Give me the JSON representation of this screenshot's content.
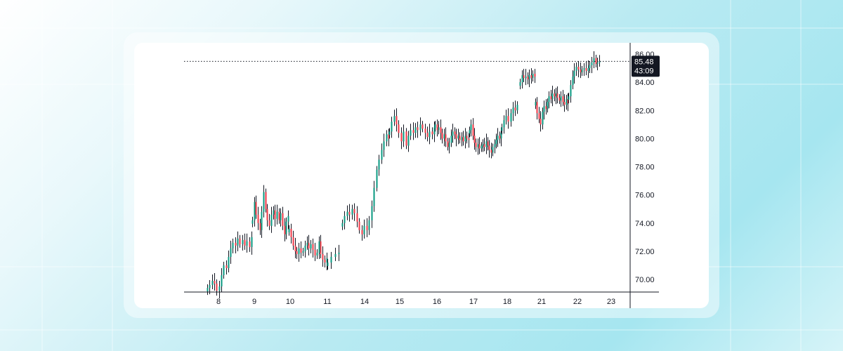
{
  "chart_data": {
    "type": "candlestick",
    "title": "",
    "xlabel": "",
    "ylabel": "",
    "ylim": [
      69.0,
      86.6
    ],
    "y_ticks": [
      "70.00",
      "72.00",
      "74.00",
      "76.00",
      "78.00",
      "80.00",
      "82.00",
      "84.00",
      "86.00"
    ],
    "x_ticks": [
      "8",
      "9",
      "10",
      "11",
      "14",
      "15",
      "16",
      "17",
      "18",
      "21",
      "22",
      "23"
    ],
    "last_price": "85.48",
    "countdown": "43:09",
    "grid": false,
    "legend": "none",
    "colors": {
      "up": "#089981",
      "down": "#f23645",
      "wick": "#131722",
      "badge": "#131722"
    },
    "sessions": [
      {
        "day": "8",
        "prices": [
          69.4,
          69.6,
          69.9,
          69.7,
          69.2,
          69.5,
          70.3,
          71.0,
          70.8,
          71.6,
          72.2,
          72.6,
          72.4,
          72.9,
          72.5,
          72.8,
          72.4,
          72.7,
          72.3,
          73.0
        ]
      },
      {
        "day": "9",
        "prices": [
          74.2,
          75.5,
          74.6,
          74.0,
          73.5,
          74.8,
          76.2,
          75.0,
          74.2,
          73.8,
          74.6,
          74.9,
          74.3,
          74.8,
          74.2,
          74.7,
          73.8,
          73.2,
          74.1,
          74.5
        ]
      },
      {
        "day": "10",
        "prices": [
          73.6,
          73.0,
          72.4,
          72.0,
          71.8,
          72.2,
          71.9,
          72.0,
          72.4,
          72.6,
          72.2,
          72.5,
          72.1,
          71.7,
          71.9,
          72.7,
          71.8,
          71.4,
          71.2,
          71.5
        ]
      },
      {
        "day": "11",
        "prices": [
          71.2,
          71.6,
          71.8,
          71.9
        ]
      },
      {
        "day": "14",
        "prices": [
          74.0,
          74.5,
          74.8,
          74.6,
          75.0,
          74.7,
          74.1,
          73.5,
          73.2,
          73.8,
          73.5,
          74.2,
          75.2,
          76.5,
          77.8,
          78.5,
          79.2,
          79.8,
          80.3,
          80.0
        ]
      },
      {
        "day": "15",
        "prices": [
          80.5,
          81.2,
          81.6,
          81.0,
          80.4,
          79.8,
          80.5,
          79.5,
          80.2,
          80.6,
          80.4,
          80.8,
          80.6,
          81.0,
          80.7,
          80.4,
          80.1,
          80.5,
          80.3,
          80.8
        ]
      },
      {
        "day": "16",
        "prices": [
          81.0,
          80.6,
          80.8,
          80.4,
          80.0,
          80.3,
          79.8,
          79.4,
          79.7,
          80.2,
          80.5,
          80.3,
          80.0,
          80.2,
          79.9,
          80.1,
          79.8,
          80.2,
          80.0,
          79.9
        ]
      },
      {
        "day": "17",
        "prices": [
          80.6,
          81.0,
          80.2,
          79.7,
          79.4,
          79.6,
          79.3,
          79.5,
          79.6,
          79.4,
          79.8,
          79.5,
          79.2,
          79.0,
          79.4,
          79.6,
          79.9,
          80.2,
          80.0,
          80.4
        ]
      },
      {
        "day": "18",
        "prices": [
          80.8,
          81.3,
          81.6,
          81.2,
          81.8,
          82.2,
          82.0,
          82.4
        ]
      },
      {
        "day": "18b",
        "prices": [
          84.0,
          84.5,
          84.3,
          84.4,
          84.2,
          84.5,
          84.3,
          84.6,
          84.4
        ]
      },
      {
        "day": "21",
        "prices": [
          82.6,
          81.8,
          81.4,
          81.0,
          81.9,
          82.3,
          82.1,
          82.6,
          83.0,
          82.8,
          83.2,
          83.0,
          83.2,
          82.9,
          82.7,
          83.0,
          82.6,
          82.4,
          82.8,
          82.5
        ]
      },
      {
        "day": "22",
        "prices": [
          83.0,
          83.8,
          84.4,
          84.8,
          85.1,
          84.9,
          84.7,
          84.9,
          85.0,
          84.8,
          85.0,
          85.2,
          85.4,
          85.7,
          85.3,
          85.4,
          85.48
        ]
      }
    ]
  }
}
